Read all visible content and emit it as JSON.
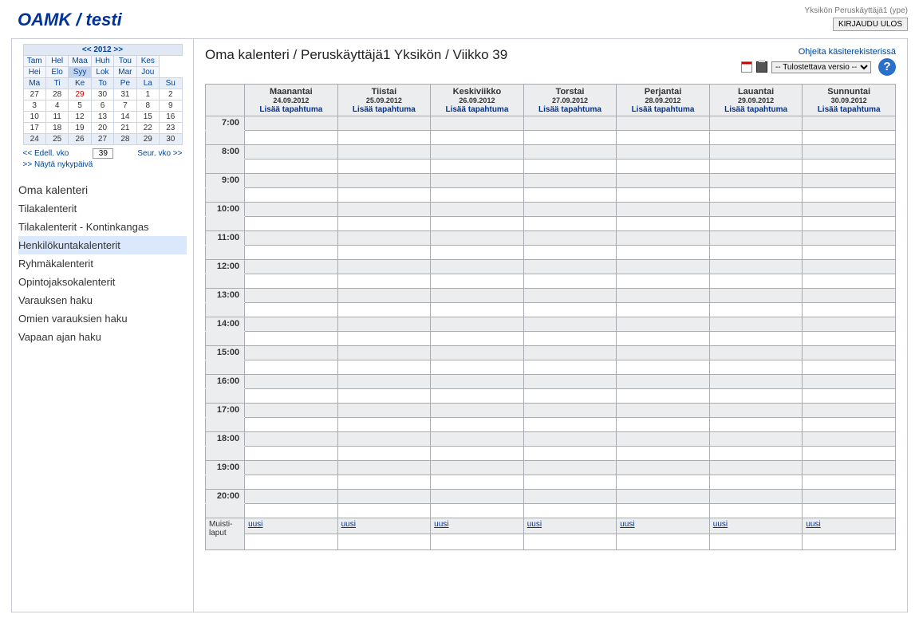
{
  "header": {
    "logo": "OAMK / testi",
    "user_line": "Yksikön Peruskäyttäjä1 (ype)",
    "logout": "KIRJAUDU ULOS"
  },
  "minical": {
    "year_nav": "<< 2012 >>",
    "months_row1": [
      "Tam",
      "Hel",
      "Maa",
      "Huh",
      "Tou",
      "Kes"
    ],
    "months_row2": [
      "Hei",
      "Elo",
      "Syy",
      "Lok",
      "Mar",
      "Jou"
    ],
    "selected_month_index_row2": 2,
    "day_headers": [
      "Ma",
      "Ti",
      "Ke",
      "To",
      "Pe",
      "La",
      "Su"
    ],
    "weeks": [
      [
        27,
        28,
        29,
        30,
        31,
        1,
        2
      ],
      [
        3,
        4,
        5,
        6,
        7,
        8,
        9
      ],
      [
        10,
        11,
        12,
        13,
        14,
        15,
        16
      ],
      [
        17,
        18,
        19,
        20,
        21,
        22,
        23
      ],
      [
        24,
        25,
        26,
        27,
        28,
        29,
        30
      ]
    ],
    "today": 29,
    "current_week_index": 4,
    "prev_week": "<< Edell. vko",
    "week_input": "39",
    "next_week": "Seur. vko >>",
    "show_today": ">> Näytä nykypäivä"
  },
  "nav": {
    "heading": "Oma kalenteri",
    "items": [
      "Tilakalenterit",
      "Tilakalenterit - Kontinkangas",
      "Henkilökuntakalenterit",
      "Ryhmäkalenterit",
      "Opintojaksokalenterit",
      "Varauksen haku",
      "Omien varauksien haku",
      "Vapaan ajan haku"
    ],
    "selected_index": 2
  },
  "main": {
    "title": "Oma kalenteri / Peruskäyttäjä1 Yksikön / Viikko 39",
    "help_link": "Ohjeita käsiterekisterissä",
    "print_select": "-- Tulostettava versio --",
    "days": [
      {
        "name": "Maanantai",
        "date": "24.09.2012",
        "add": "Lisää tapahtuma"
      },
      {
        "name": "Tiistai",
        "date": "25.09.2012",
        "add": "Lisää tapahtuma"
      },
      {
        "name": "Keskiviikko",
        "date": "26.09.2012",
        "add": "Lisää tapahtuma"
      },
      {
        "name": "Torstai",
        "date": "27.09.2012",
        "add": "Lisää tapahtuma"
      },
      {
        "name": "Perjantai",
        "date": "28.09.2012",
        "add": "Lisää tapahtuma"
      },
      {
        "name": "Lauantai",
        "date": "29.09.2012",
        "add": "Lisää tapahtuma"
      },
      {
        "name": "Sunnuntai",
        "date": "30.09.2012",
        "add": "Lisää tapahtuma"
      }
    ],
    "hours": [
      "7:00",
      "8:00",
      "9:00",
      "10:00",
      "11:00",
      "12:00",
      "13:00",
      "14:00",
      "15:00",
      "16:00",
      "17:00",
      "18:00",
      "19:00",
      "20:00"
    ],
    "notes_label": "Muisti-\nlaput",
    "notes_new": "uusi"
  }
}
